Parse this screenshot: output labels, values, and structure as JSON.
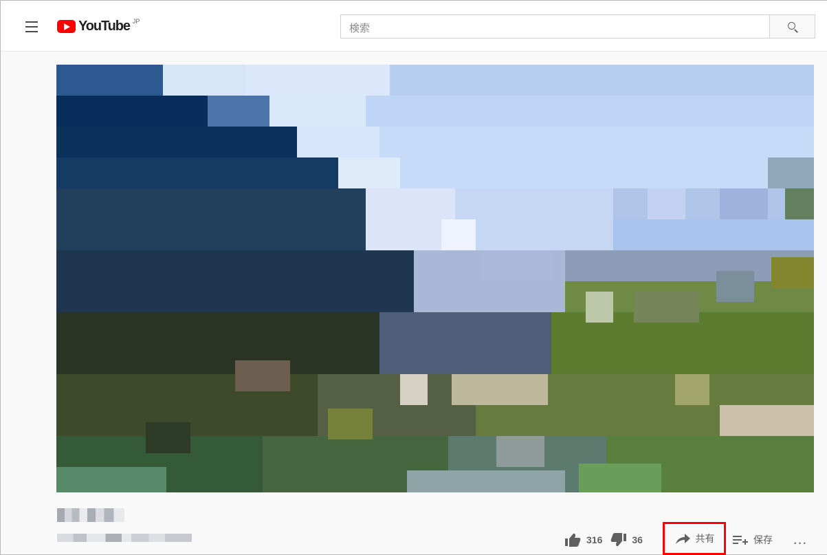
{
  "masthead": {
    "menu_icon": "hamburger-menu-icon",
    "brand": "YouTube",
    "country": "JP",
    "search_placeholder": "検索",
    "search_icon": "search-icon"
  },
  "video": {
    "thumbnail_description": "pixelated mountain landscape",
    "title": "",
    "channel_meta": ""
  },
  "actions": {
    "likes": "316",
    "dislikes": "36",
    "share_label": "共有",
    "save_label": "保存",
    "more_label": "..."
  },
  "colors": {
    "brand_red": "#ff0000",
    "text_gray": "#606060",
    "highlight_red": "#ff0000",
    "page_background": "#f9f9f9",
    "masthead_background": "#ffffff",
    "sky_blue": "#a9c7ef",
    "mountain_dark": "#143454",
    "grass_green": "#557b43"
  }
}
